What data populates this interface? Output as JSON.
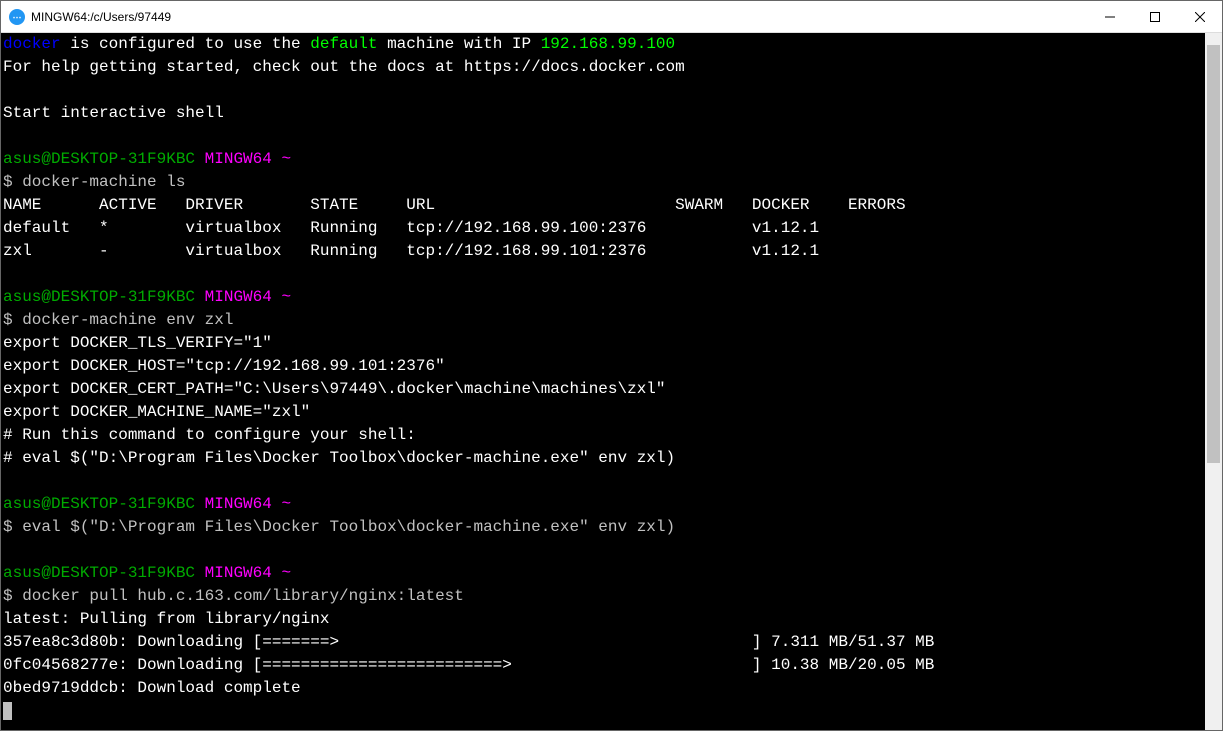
{
  "window": {
    "title": "MINGW64:/c/Users/97449"
  },
  "intro": {
    "word_docker": "docker",
    "text1": " is configured to use the ",
    "word_default": "default",
    "text2": " machine with IP ",
    "ip": "192.168.99.100",
    "help": "For help getting started, check out the docs at https://docs.docker.com",
    "start": "Start interactive shell"
  },
  "prompt": {
    "userhost": "asus@DESKTOP-31F9KBC",
    "shell": "MINGW64",
    "tilde": "~",
    "dollar": "$ "
  },
  "cmd1": "docker-machine ls",
  "table": {
    "header": "NAME      ACTIVE   DRIVER       STATE     URL                         SWARM   DOCKER    ERRORS",
    "row1": "default   *        virtualbox   Running   tcp://192.168.99.100:2376           v1.12.1",
    "row2": "zxl       -        virtualbox   Running   tcp://192.168.99.101:2376           v1.12.1"
  },
  "cmd2": "docker-machine env zxl",
  "env": {
    "l1": "export DOCKER_TLS_VERIFY=\"1\"",
    "l2": "export DOCKER_HOST=\"tcp://192.168.99.101:2376\"",
    "l3": "export DOCKER_CERT_PATH=\"C:\\Users\\97449\\.docker\\machine\\machines\\zxl\"",
    "l4": "export DOCKER_MACHINE_NAME=\"zxl\"",
    "l5": "# Run this command to configure your shell:",
    "l6": "# eval $(\"D:\\Program Files\\Docker Toolbox\\docker-machine.exe\" env zxl)"
  },
  "cmd3": "eval $(\"D:\\Program Files\\Docker Toolbox\\docker-machine.exe\" env zxl)",
  "cmd4": "docker pull hub.c.163.com/library/nginx:latest",
  "pull": {
    "l1": "latest: Pulling from library/nginx",
    "l2": "357ea8c3d80b: Downloading [=======>                                           ] 7.311 MB/51.37 MB",
    "l3": "0fc04568277e: Downloading [=========================>                         ] 10.38 MB/20.05 MB",
    "l4": "0bed9719ddcb: Download complete"
  }
}
